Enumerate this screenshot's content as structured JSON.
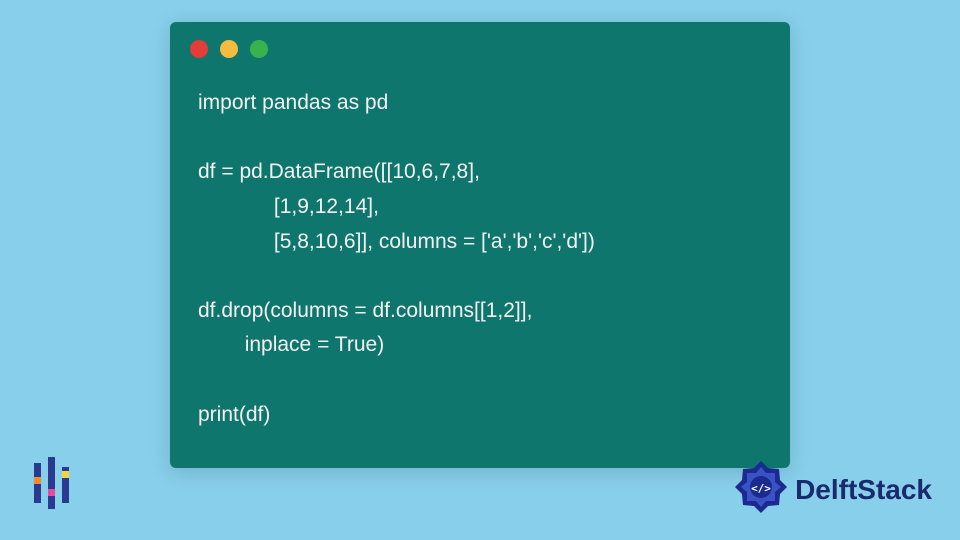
{
  "code_window": {
    "lines": "import pandas as pd\n\ndf = pd.DataFrame([[10,6,7,8],\n             [1,9,12,14],\n             [5,8,10,6]], columns = ['a','b','c','d'])\n\ndf.drop(columns = df.columns[[1,2]],\n        inplace = True)\n\nprint(df)"
  },
  "brand": {
    "name": "DelftStack"
  }
}
